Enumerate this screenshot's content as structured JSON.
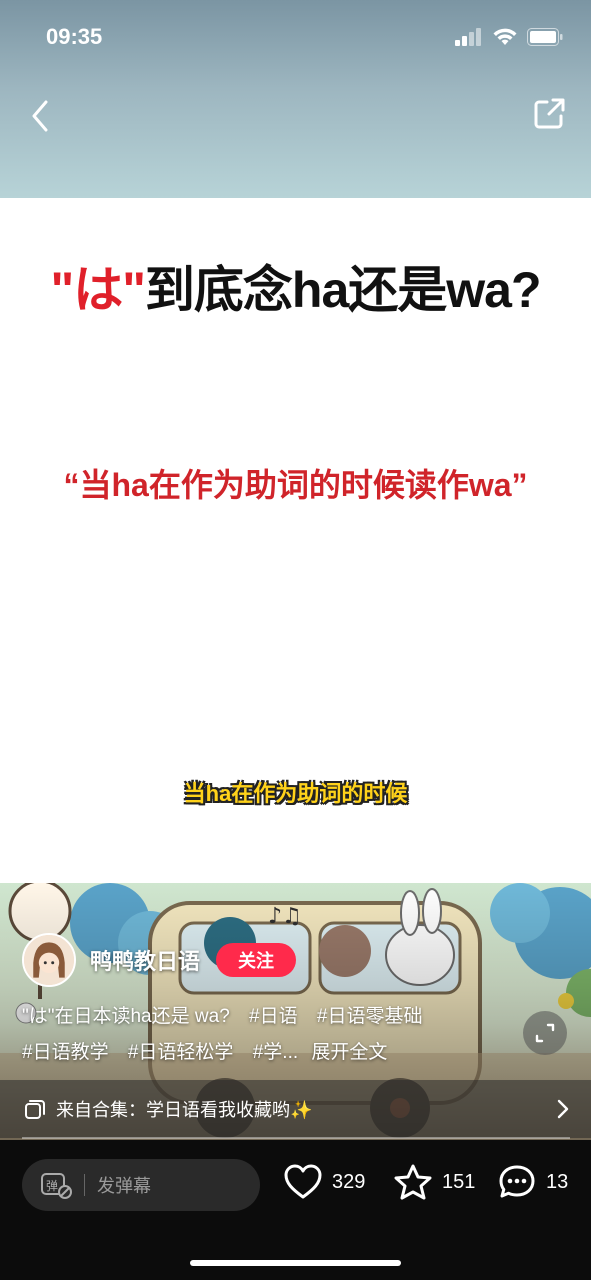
{
  "status_bar": {
    "time": "09:35"
  },
  "nav": {
    "back_icon": "chevron-left-icon",
    "share_icon": "share-out-icon"
  },
  "video": {
    "headline_prefix_quote_open": "\"",
    "headline_char": "は",
    "headline_prefix_quote_close": "\"",
    "headline_rest": "到底念ha还是wa?",
    "subline": "“当ha在作为助词的时候读作wa”",
    "caption": "当ha在作为助词的时候"
  },
  "author": {
    "name": "鸭鸭教日语",
    "follow_label": "关注"
  },
  "description": {
    "title": "\"は\"在日本读ha还是 wa?",
    "tags": [
      "#日语",
      "#日语零基础",
      "#日语教学",
      "#日语轻松学",
      "#学..."
    ],
    "expand_label": "展开全文"
  },
  "collection": {
    "label": "来自合集：学日语看我收藏哟✨"
  },
  "bottom_bar": {
    "danmu_placeholder": "发弹幕",
    "likes": "329",
    "favorites": "151",
    "comments": "13"
  },
  "colors": {
    "follow": "#ff2a4b",
    "headline_red": "#e0202a",
    "caption_yellow": "#ffd21a"
  }
}
